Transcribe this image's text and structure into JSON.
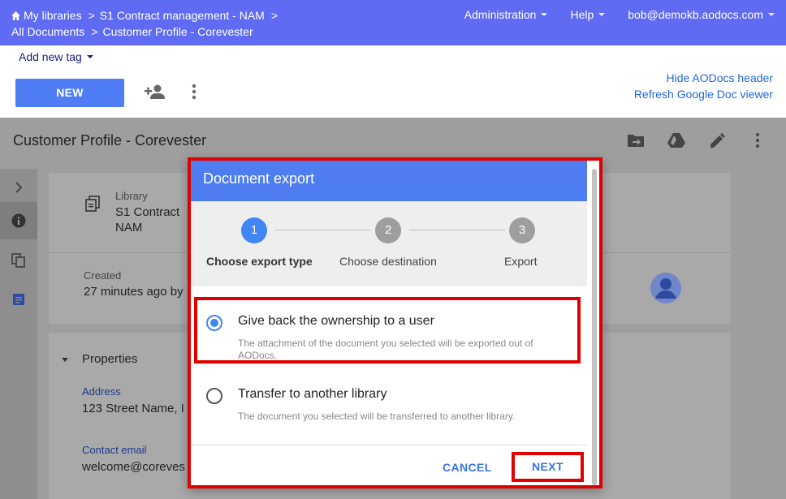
{
  "breadcrumbs": {
    "row1": [
      "My libraries",
      "S1 Contract management - NAM"
    ],
    "row2": [
      "All Documents",
      "Customer Profile - Corevester"
    ],
    "separator": ">"
  },
  "topnav": {
    "administration": "Administration",
    "help": "Help",
    "user_email": "bob@demokb.aodocs.com"
  },
  "toolbar": {
    "add_tag": "Add new tag",
    "new_button": "NEW",
    "hide_header_link": "Hide AODocs header",
    "refresh_viewer_link": "Refresh Google Doc viewer"
  },
  "document": {
    "title": "Customer Profile - Corevester",
    "library_label": "Library",
    "library_value_line1": "S1 Contract",
    "library_value_line2": "NAM",
    "created_label": "Created",
    "created_value": "27 minutes ago by",
    "properties_heading": "Properties",
    "address_label": "Address",
    "address_value": "123 Street Name, I",
    "contact_email_label": "Contact email",
    "contact_email_value": "welcome@coreves"
  },
  "dialog": {
    "title": "Document export",
    "steps": [
      {
        "number": "1",
        "label": "Choose export type"
      },
      {
        "number": "2",
        "label": "Choose destination"
      },
      {
        "number": "3",
        "label": "Export"
      }
    ],
    "options": [
      {
        "title": "Give back the ownership to a user",
        "description": "The attachment of the document you selected will be exported out of AODocs.",
        "selected": true
      },
      {
        "title": "Transfer to another library",
        "description": "The document you selected will be transferred to another library.",
        "selected": false
      }
    ],
    "cancel_label": "CANCEL",
    "next_label": "NEXT"
  },
  "colors": {
    "topbar": "#5f6bf2",
    "primary": "#4d7df0",
    "highlight_border": "#e00000",
    "step_active": "#4285f4",
    "step_inactive": "#9e9e9e"
  }
}
